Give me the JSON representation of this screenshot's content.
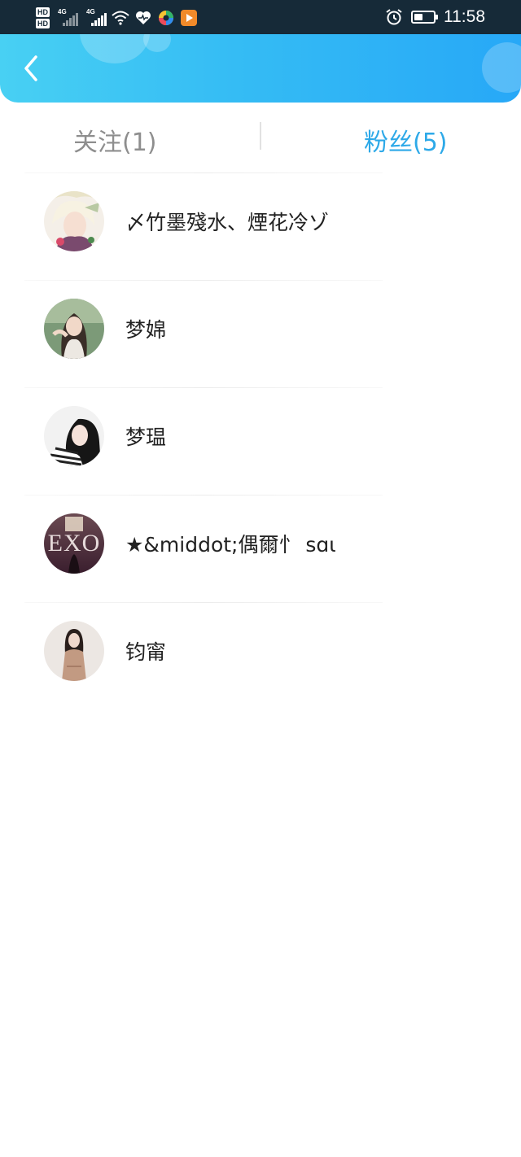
{
  "status_bar": {
    "sim1_label": "HD",
    "sim2_label": "HD",
    "network1": "4G",
    "network2": "4G",
    "time": "11:58"
  },
  "header": {
    "back_icon": "chevron-left-icon"
  },
  "tabs": [
    {
      "label": "关注(1)",
      "active": false
    },
    {
      "label": "粉丝(5)",
      "active": true
    }
  ],
  "fans": [
    {
      "name": "〆竹墨殘水、煙花冷ゾ"
    },
    {
      "name": "梦婂"
    },
    {
      "name": "梦瑥"
    },
    {
      "name": "★&middot;偶爾忄 sɑι",
      "avatar_text": "EXO"
    },
    {
      "name": "钧甯"
    }
  ],
  "colors": {
    "status_bar_bg": "#162a38",
    "header_gradient_start": "#48d0f3",
    "header_gradient_end": "#27a8f7",
    "active_tab": "#2da9e8",
    "inactive_tab": "#8e8e8e"
  }
}
